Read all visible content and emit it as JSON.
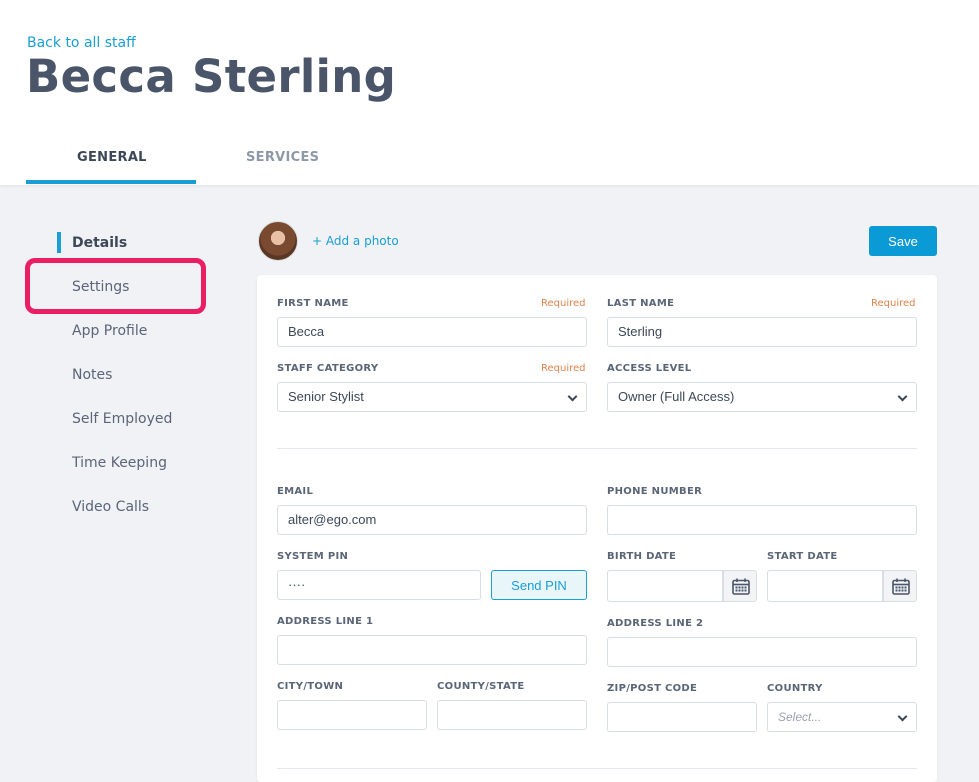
{
  "header": {
    "back_link": "Back to all staff",
    "title": "Becca Sterling",
    "tabs": [
      {
        "label": "GENERAL",
        "active": true
      },
      {
        "label": "SERVICES",
        "active": false
      }
    ]
  },
  "sidebar": {
    "items": [
      {
        "label": "Details",
        "active": true
      },
      {
        "label": "Settings",
        "highlighted": true
      },
      {
        "label": "App Profile"
      },
      {
        "label": "Notes"
      },
      {
        "label": "Self Employed"
      },
      {
        "label": "Time Keeping"
      },
      {
        "label": "Video Calls"
      }
    ]
  },
  "photo": {
    "add_label": "+ Add a photo"
  },
  "actions": {
    "save_label": "Save"
  },
  "form": {
    "required_label": "Required",
    "first_name": {
      "label": "FIRST NAME",
      "value": "Becca"
    },
    "last_name": {
      "label": "LAST NAME",
      "value": "Sterling"
    },
    "staff_category": {
      "label": "STAFF CATEGORY",
      "value": "Senior Stylist"
    },
    "access_level": {
      "label": "ACCESS LEVEL",
      "value": "Owner (Full Access)"
    },
    "email": {
      "label": "EMAIL",
      "value": "alter@ego.com"
    },
    "phone": {
      "label": "PHONE NUMBER",
      "value": ""
    },
    "system_pin": {
      "label": "SYSTEM PIN",
      "value": "····",
      "send_label": "Send PIN"
    },
    "birth_date": {
      "label": "BIRTH DATE",
      "value": ""
    },
    "start_date": {
      "label": "START DATE",
      "value": ""
    },
    "address1": {
      "label": "ADDRESS LINE 1",
      "value": ""
    },
    "address2": {
      "label": "ADDRESS LINE 2",
      "value": ""
    },
    "city": {
      "label": "CITY/TOWN",
      "value": ""
    },
    "county": {
      "label": "COUNTY/STATE",
      "value": ""
    },
    "zip": {
      "label": "ZIP/POST CODE",
      "value": ""
    },
    "country": {
      "label": "COUNTRY",
      "placeholder": "Select..."
    }
  },
  "colors": {
    "accent": "#1a9fd5",
    "highlight": "#ea1e63",
    "required": "#e0824a",
    "title": "#4a5569"
  },
  "icons": [
    "calendar-icon",
    "chevron-down-icon",
    "avatar-photo"
  ]
}
